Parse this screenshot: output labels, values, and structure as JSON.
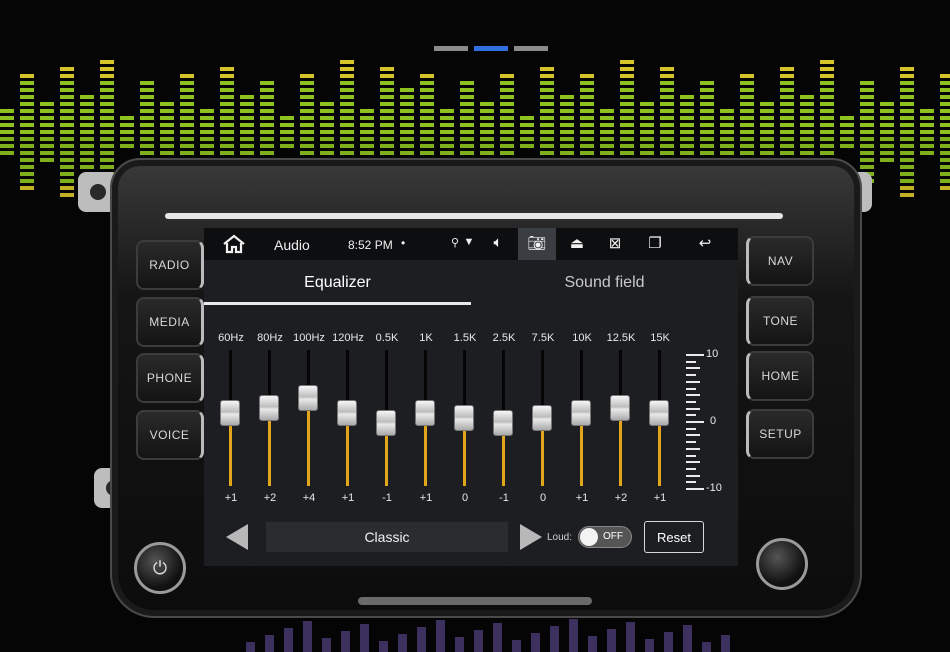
{
  "carousel": {
    "count": 3,
    "active_index": 1
  },
  "side_buttons": {
    "left": [
      "RADIO",
      "MEDIA",
      "PHONE",
      "VOICE"
    ],
    "right": [
      "NAV",
      "TONE",
      "HOME",
      "SETUP"
    ]
  },
  "status_bar": {
    "app_title": "Audio",
    "time": "8:52 PM",
    "icons": [
      "home-icon",
      "location-icon",
      "wifi-icon",
      "volume-icon",
      "camera-icon",
      "eject-icon",
      "close-window-icon",
      "multi-window-icon",
      "back-icon"
    ]
  },
  "tabs": {
    "equalizer": "Equalizer",
    "sound_field": "Sound field",
    "active": "equalizer"
  },
  "equalizer": {
    "range": [
      -10,
      10
    ],
    "scale_labels": {
      "top": "10",
      "mid": "0",
      "bottom": "-10"
    },
    "bands": [
      {
        "freq": "60Hz",
        "value": 1,
        "label": "+1"
      },
      {
        "freq": "80Hz",
        "value": 2,
        "label": "+2"
      },
      {
        "freq": "100Hz",
        "value": 4,
        "label": "+4"
      },
      {
        "freq": "120Hz",
        "value": 1,
        "label": "+1"
      },
      {
        "freq": "0.5K",
        "value": -1,
        "label": "-1"
      },
      {
        "freq": "1K",
        "value": 1,
        "label": "+1"
      },
      {
        "freq": "1.5K",
        "value": 0,
        "label": "0"
      },
      {
        "freq": "2.5K",
        "value": -1,
        "label": "-1"
      },
      {
        "freq": "7.5K",
        "value": 0,
        "label": "0"
      },
      {
        "freq": "10K",
        "value": 1,
        "label": "+1"
      },
      {
        "freq": "12.5K",
        "value": 2,
        "label": "+2"
      },
      {
        "freq": "15K",
        "value": 1,
        "label": "+1"
      }
    ],
    "preset": "Classic",
    "loud_label": "Loud:",
    "loud_state": "OFF",
    "reset_label": "Reset"
  },
  "colors": {
    "accent": "#e3a51a",
    "viz_green": "#8ec21f",
    "viz_yellow": "#d6c32a",
    "active_dot": "#2f6fe0"
  }
}
